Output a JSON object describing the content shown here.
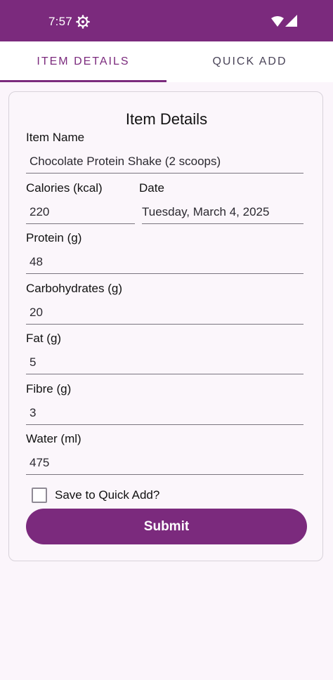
{
  "status_bar": {
    "time": "7:57",
    "icons": [
      "gear-icon",
      "wifi-icon",
      "signal-icon"
    ],
    "color": "#7b2a7d"
  },
  "tabs": [
    {
      "label": "ITEM DETAILS",
      "active": true
    },
    {
      "label": "QUICK ADD",
      "active": false
    }
  ],
  "form": {
    "title": "Item Details",
    "item_name": {
      "label": "Item Name",
      "value": "Chocolate Protein Shake (2 scoops)"
    },
    "calories": {
      "label": "Calories (kcal)",
      "value": "220"
    },
    "date": {
      "label": "Date",
      "value": "Tuesday, March 4, 2025"
    },
    "protein": {
      "label": "Protein (g)",
      "value": "48"
    },
    "carbohydrates": {
      "label": "Carbohydrates (g)",
      "value": "20"
    },
    "fat": {
      "label": "Fat (g)",
      "value": "5"
    },
    "fibre": {
      "label": "Fibre (g)",
      "value": "3"
    },
    "water": {
      "label": "Water (ml)",
      "value": "475"
    },
    "save_quick_add": {
      "label": "Save to Quick Add?",
      "checked": false
    },
    "submit_label": "Submit"
  },
  "colors": {
    "accent": "#7b2a7d",
    "background": "#fbf5fb"
  }
}
